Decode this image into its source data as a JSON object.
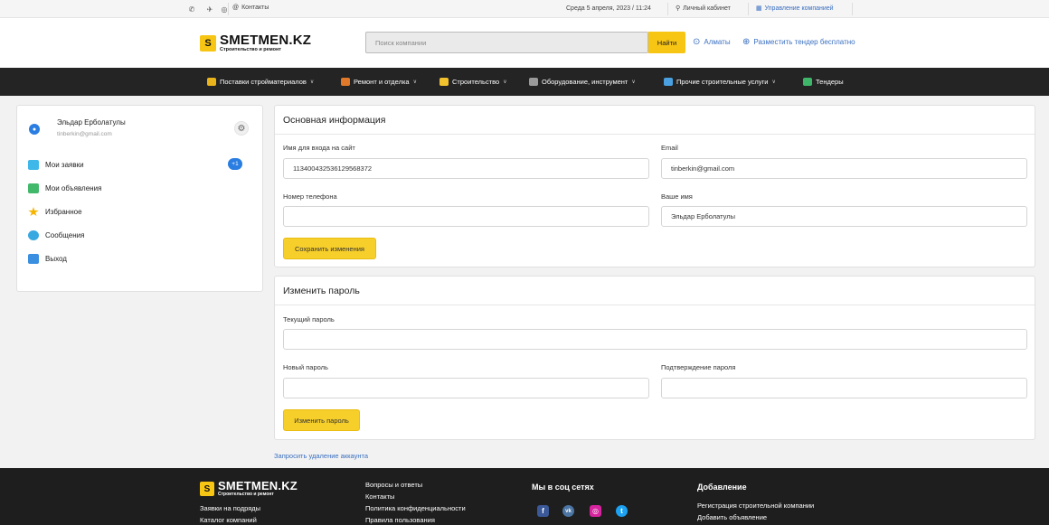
{
  "topbar": {
    "icons": [
      "whatsapp-icon",
      "telegram-icon",
      "instagram-icon"
    ],
    "contacts_label": "Контакты",
    "date": "Среда 5 апреля, 2023 / 11:24",
    "cabinet_label": "Личный кабинет",
    "manage_label": "Управление компанией"
  },
  "header": {
    "logo_name": "SMETMEN.KZ",
    "logo_tagline": "Строительство и ремонт",
    "logo_letter": "S",
    "search_placeholder": "Поиск компании",
    "search_button": "Найти",
    "city": "Алматы",
    "tender_link": "Разместить тендер бесплатно"
  },
  "nav": {
    "items": [
      {
        "label": "Поставки стройматериалов",
        "chevron": "∨",
        "color": "#e8b31b"
      },
      {
        "label": "Ремонт и отделка",
        "chevron": "∨",
        "color": "#e07a2a"
      },
      {
        "label": "Строительство",
        "chevron": "∨",
        "color": "#f2c12e"
      },
      {
        "label": "Оборудование, инструмент",
        "chevron": "∨",
        "color": "#9a9a9a"
      },
      {
        "label": "Прочие строительные услуги",
        "chevron": "∨",
        "color": "#4aa0e0"
      },
      {
        "label": "Тендеры",
        "chevron": "",
        "color": "#3fb56a"
      }
    ]
  },
  "sidebar": {
    "user_name": "Эльдар Ерболатулы",
    "user_email": "tinberkin@gmail.com",
    "badge": "+1",
    "items": [
      {
        "label": "Мои заявки",
        "color": "#3db8e8"
      },
      {
        "label": "Мои объявления",
        "color": "#41b86a"
      },
      {
        "label": "Избранное",
        "color": "#f5b400"
      },
      {
        "label": "Сообщения",
        "color": "#38a8e0"
      },
      {
        "label": "Выход",
        "color": "#3b8fe0"
      }
    ]
  },
  "info_card": {
    "title": "Основная информация",
    "login_label": "Имя для входа на сайт",
    "login_value": "113400432536129568372",
    "email_label": "Email",
    "email_value": "tinberkin@gmail.com",
    "phone_label": "Номер телефона",
    "phone_value": "",
    "name_label": "Ваше имя",
    "name_value": "Эльдар Ерболатулы",
    "save_button": "Сохранить изменения"
  },
  "password_card": {
    "title": "Изменить пароль",
    "current_label": "Текущий пароль",
    "new_label": "Новый пароль",
    "confirm_label": "Подтверждение пароля",
    "change_button": "Изменить пароль"
  },
  "delete_link": "Запросить удаление аккаунта",
  "footer": {
    "logo_name": "SMETMEN.KZ",
    "logo_tagline": "Строительство и ремонт",
    "logo_letter": "S",
    "col1": [
      "Заявки на подряды",
      "Каталог компаний"
    ],
    "col2": [
      "Вопросы и ответы",
      "Контакты",
      "Политика конфиденциальности",
      "Правила пользования"
    ],
    "social_title": "Мы в соц сетях",
    "social": [
      {
        "name": "facebook-icon",
        "glyph": "f",
        "color": "#3b5998"
      },
      {
        "name": "vk-icon",
        "glyph": "vk",
        "color": "#4c75a3"
      },
      {
        "name": "instagram-icon",
        "glyph": "◎",
        "color": "#d6249f"
      },
      {
        "name": "twitter-icon",
        "glyph": "t",
        "color": "#1da1f2"
      }
    ],
    "add_title": "Добавление",
    "add_links": [
      "Регистрация строительной компании",
      "Добавить объявление"
    ]
  }
}
